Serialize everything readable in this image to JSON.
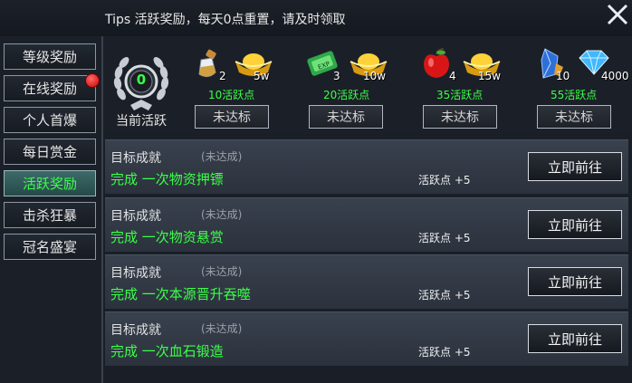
{
  "tips": "Tips  活跃奖励，每天0点重置，请及时领取",
  "sidebar": {
    "tabs": [
      {
        "label": "等级奖励"
      },
      {
        "label": "在线奖励"
      },
      {
        "label": "个人首爆"
      },
      {
        "label": "每日赏金"
      },
      {
        "label": "活跃奖励"
      },
      {
        "label": "击杀狂暴"
      },
      {
        "label": "冠名盛宴"
      }
    ],
    "active_index": 4
  },
  "activity": {
    "value": "0",
    "label": "当前活跃"
  },
  "rewards": [
    {
      "items": [
        {
          "icon": "potion-icon",
          "count": "2"
        },
        {
          "icon": "gold-ingot-icon",
          "count": "5w"
        }
      ],
      "points": "10活跃点",
      "status": "未达标"
    },
    {
      "items": [
        {
          "icon": "scroll-icon",
          "count": "3"
        },
        {
          "icon": "gold-ingot-icon",
          "count": "10w"
        }
      ],
      "points": "20活跃点",
      "status": "未达标"
    },
    {
      "items": [
        {
          "icon": "apple-icon",
          "count": "4"
        },
        {
          "icon": "gold-ingot-icon",
          "count": "15w"
        }
      ],
      "points": "35活跃点",
      "status": "未达标"
    },
    {
      "items": [
        {
          "icon": "crystal-icon",
          "count": "10"
        },
        {
          "icon": "diamond-icon",
          "count": "4000"
        }
      ],
      "points": "55活跃点",
      "status": "未达标"
    }
  ],
  "tasks": [
    {
      "title": "目标成就",
      "status": "(未达成)",
      "desc": "完成 一次物资押镖",
      "points": "活跃点 +5",
      "button": "立即前往"
    },
    {
      "title": "目标成就",
      "status": "(未达成)",
      "desc": "完成 一次物资悬赏",
      "points": "活跃点 +5",
      "button": "立即前往"
    },
    {
      "title": "目标成就",
      "status": "(未达成)",
      "desc": "完成 一次本源晋升吞噬",
      "points": "活跃点 +5",
      "button": "立即前往"
    },
    {
      "title": "目标成就",
      "status": "(未达成)",
      "desc": "完成 一次血石锻造",
      "points": "活跃点 +5",
      "button": "立即前往"
    }
  ],
  "colors": {
    "accent_green": "#3bff48",
    "red_dot": "#e00000"
  }
}
